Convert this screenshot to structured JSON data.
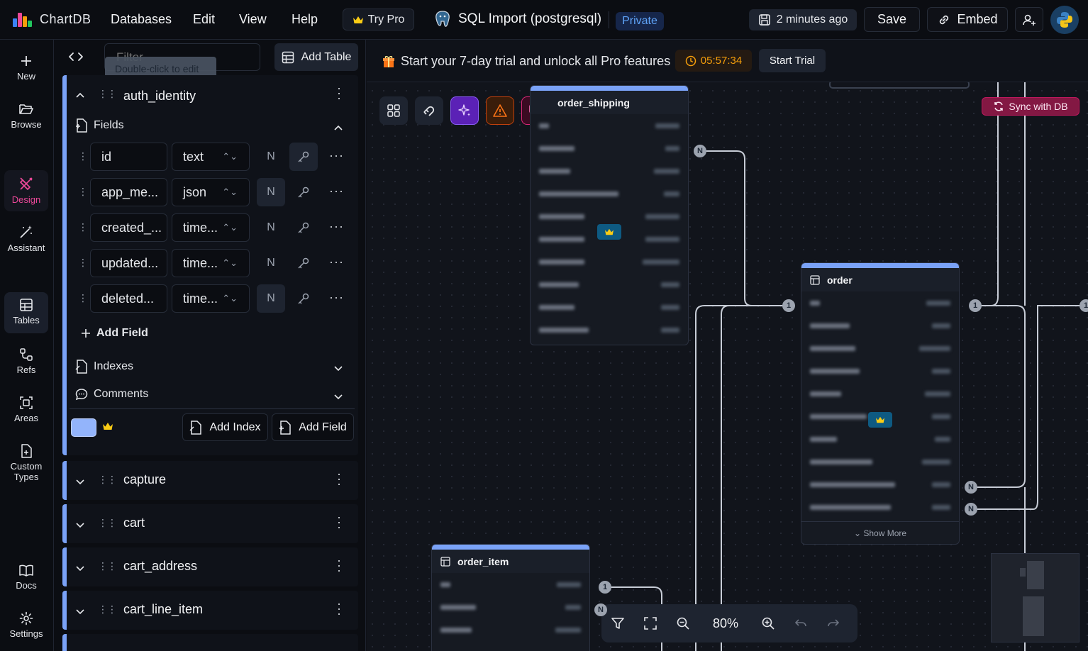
{
  "app": {
    "name": "ChartDB",
    "brand_color": "#ec4899"
  },
  "menu": [
    "Databases",
    "Edit",
    "View",
    "Help"
  ],
  "try_pro": "Try Pro",
  "database": {
    "title": "SQL Import (postgresql)",
    "visibility": "Private"
  },
  "save_status": "2 minutes ago",
  "buttons": {
    "save": "Save",
    "embed": "Embed"
  },
  "rail": {
    "new": "New",
    "browse": "Browse",
    "design": "Design",
    "assistant": "Assistant",
    "tables": "Tables",
    "refs": "Refs",
    "areas": "Areas",
    "custom_types": "Custom Types",
    "docs": "Docs",
    "settings": "Settings"
  },
  "sidebar": {
    "filter_placeholder": "Filter",
    "tooltip": "Double-click to edit",
    "add_table": "Add Table",
    "expanded_table": {
      "name": "auth_identity",
      "fields_label": "Fields",
      "fields": [
        {
          "name": "id",
          "type": "text",
          "nullable": false,
          "primary_key": true
        },
        {
          "name": "app_me...",
          "type": "json",
          "nullable": true,
          "primary_key": false
        },
        {
          "name": "created_...",
          "type": "time...",
          "nullable": false,
          "primary_key": false
        },
        {
          "name": "updated...",
          "type": "time...",
          "nullable": false,
          "primary_key": false
        },
        {
          "name": "deleted...",
          "type": "time...",
          "nullable": true,
          "primary_key": false
        }
      ],
      "add_field": "Add Field",
      "indexes_label": "Indexes",
      "comments_label": "Comments",
      "add_index_button": "Add Index",
      "add_field_button": "Add Field",
      "color": "#93b4fb"
    },
    "collapsed_tables": [
      "capture",
      "cart",
      "cart_address",
      "cart_line_item"
    ]
  },
  "trial": {
    "text": "Start your 7-day trial and unlock all Pro features",
    "timer": "05:57:34",
    "button": "Start Trial"
  },
  "sync": "Sync with DB",
  "nodes": {
    "order_shipping": "order_shipping",
    "order": "order",
    "order_item": "order_item",
    "show_more": "Show More"
  },
  "relations": {
    "one": "1",
    "many": "N"
  },
  "zoom": "80%"
}
